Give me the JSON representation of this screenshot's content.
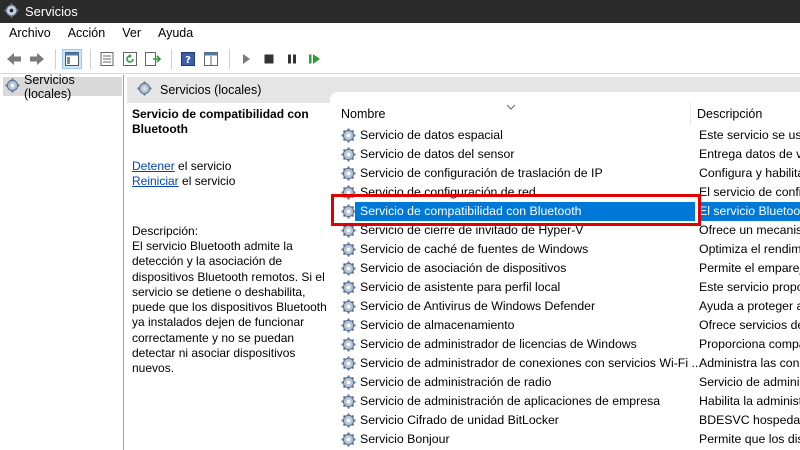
{
  "window": {
    "title": "Servicios"
  },
  "menu": [
    "Archivo",
    "Acción",
    "Ver",
    "Ayuda"
  ],
  "toolbar_icons": [
    "back-arrow-icon",
    "forward-arrow-icon",
    "console-tree-icon",
    "properties-icon",
    "refresh-icon",
    "export-icon",
    "help-icon",
    "view-icon",
    "play-icon",
    "stop-icon",
    "pause-icon",
    "restart-icon"
  ],
  "tree": {
    "label": "Servicios (locales)"
  },
  "pane": {
    "title": "Servicios (locales)"
  },
  "details": {
    "title": "Servicio de compatibilidad con Bluetooth",
    "stop_link": "Detener",
    "stop_suffix": " el servicio",
    "restart_link": "Reiniciar",
    "restart_suffix": " el servicio",
    "description_label": "Descripción:",
    "description_text": "El servicio Bluetooth admite la detección y la asociación de dispositivos Bluetooth remotos. Si el servicio se detiene o deshabilita, puede que los dispositivos Bluetooth ya instalados dejen de funcionar correctamente y no se puedan detectar ni asociar dispositivos nuevos."
  },
  "columns": {
    "name": "Nombre",
    "description": "Descripción"
  },
  "services": [
    {
      "name": "Servicio de datos espacial",
      "description": "Este servicio se usa"
    },
    {
      "name": "Servicio de datos del sensor",
      "description": "Entrega datos de va"
    },
    {
      "name": "Servicio de configuración de traslación de IP",
      "description": "Configura y habilita"
    },
    {
      "name": "Servicio de configuración de red",
      "description": "El servicio de confi"
    },
    {
      "name": "Servicio de compatibilidad con Bluetooth",
      "description": "El servicio Bluetoot",
      "selected": true
    },
    {
      "name": "Servicio de cierre de invitado de Hyper-V",
      "description": "Ofrece un mecanism"
    },
    {
      "name": "Servicio de caché de fuentes de Windows",
      "description": "Optimiza el rendimi"
    },
    {
      "name": "Servicio de asociación de dispositivos",
      "description": "Permite el empareja"
    },
    {
      "name": "Servicio de asistente para perfil local",
      "description": "Este servicio propor"
    },
    {
      "name": "Servicio de Antivirus de Windows Defender",
      "description": "Ayuda a proteger a"
    },
    {
      "name": "Servicio de almacenamiento",
      "description": "Ofrece servicios de"
    },
    {
      "name": "Servicio de administrador de licencias de Windows",
      "description": "Proporciona compat"
    },
    {
      "name": "Servicio de administrador de conexiones con servicios Wi-Fi ...",
      "description": "Administra las cone"
    },
    {
      "name": "Servicio de administración de radio",
      "description": "Servicio de adminis"
    },
    {
      "name": "Servicio de administración de aplicaciones de empresa",
      "description": "Habilita la administ"
    },
    {
      "name": "Servicio Cifrado de unidad BitLocker",
      "description": "BDESVC hospeda el"
    },
    {
      "name": "Servicio Bonjour",
      "description": "Permite que los disp"
    }
  ],
  "colors": {
    "selection": "#0078d7",
    "highlight_box": "#e00000",
    "link": "#0645ad"
  }
}
